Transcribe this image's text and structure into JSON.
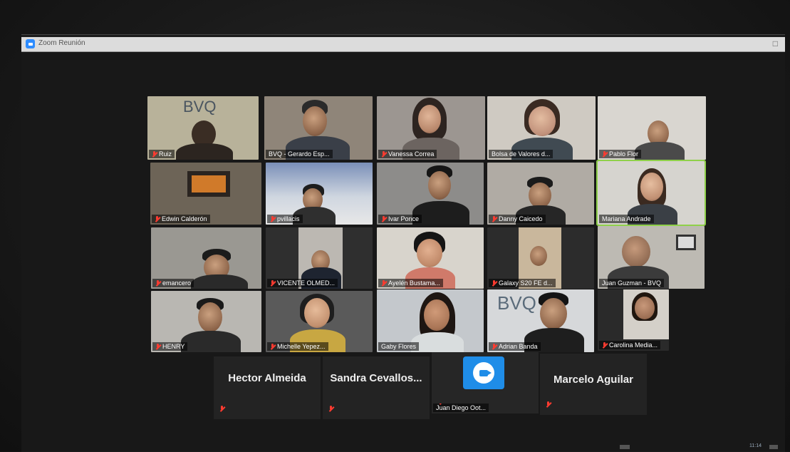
{
  "window": {
    "title": "Zoom Reunión",
    "close_label": "□"
  },
  "participants": [
    {
      "name": "Ruiz",
      "muted": true
    },
    {
      "name": "BVQ - Gerardo Esp...",
      "muted": false
    },
    {
      "name": "Vanessa Correa",
      "muted": true
    },
    {
      "name": "Bolsa de Valores d...",
      "muted": false
    },
    {
      "name": "Pablo Flor",
      "muted": true
    },
    {
      "name": "Edwin Calderón",
      "muted": true
    },
    {
      "name": "pvillacis",
      "muted": true
    },
    {
      "name": "Ivar Ponce",
      "muted": true
    },
    {
      "name": "Danny Caicedo",
      "muted": true
    },
    {
      "name": "Mariana Andrade",
      "muted": false
    },
    {
      "name": "emancero",
      "muted": true
    },
    {
      "name": "VICENTE OLMED...",
      "muted": true
    },
    {
      "name": "Ayelén Bustama...",
      "muted": true
    },
    {
      "name": "Galaxy S20 FE d...",
      "muted": true
    },
    {
      "name": "Juan Guzman - BVQ",
      "muted": false
    },
    {
      "name": "HENRY",
      "muted": true
    },
    {
      "name": "Michelle Yepez...",
      "muted": true
    },
    {
      "name": "Gaby Flores",
      "muted": false
    },
    {
      "name": "Adrian Banda",
      "muted": true
    },
    {
      "name": "Carolina Media...",
      "muted": true
    }
  ],
  "name_only": [
    {
      "name": "Hector Almeida",
      "muted": true
    },
    {
      "name": "Sandra  Cevallos...",
      "muted": true
    },
    {
      "name": "Juan Diego Oot...",
      "muted": true,
      "camera_icon": "zoom-camera-icon"
    },
    {
      "name": "Marcelo Aguilar",
      "muted": true
    }
  ],
  "clock": "11:14",
  "colors": {
    "active_speaker": "#8fd04a",
    "zoom_blue": "#1f8de8",
    "mute_red": "#ff3b30"
  }
}
